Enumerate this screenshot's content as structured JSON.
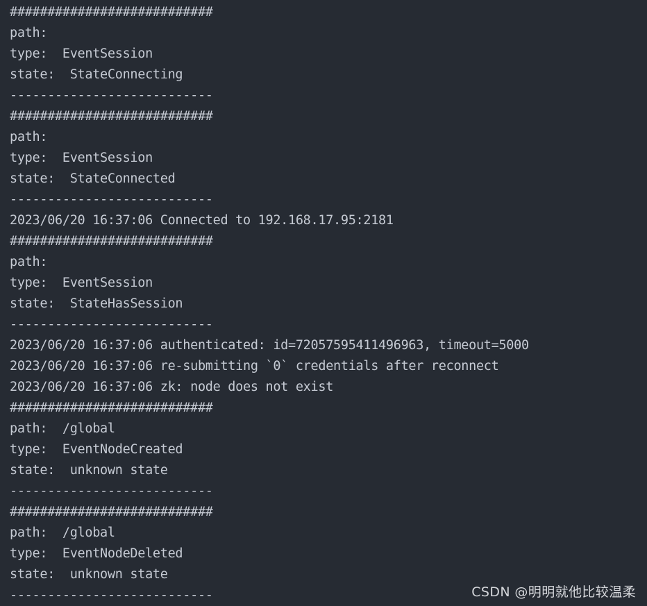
{
  "terminal": {
    "background_color": "#262b33",
    "text_color": "#c5cad3",
    "lines": [
      {
        "kind": "separator-hash",
        "text": "###########################"
      },
      {
        "kind": "field",
        "text": "path:"
      },
      {
        "kind": "field",
        "text": "type:  EventSession"
      },
      {
        "kind": "field",
        "text": "state:  StateConnecting"
      },
      {
        "kind": "separator-dash",
        "text": "---------------------------"
      },
      {
        "kind": "separator-hash",
        "text": "###########################"
      },
      {
        "kind": "field",
        "text": "path:"
      },
      {
        "kind": "field",
        "text": "type:  EventSession"
      },
      {
        "kind": "field",
        "text": "state:  StateConnected"
      },
      {
        "kind": "separator-dash",
        "text": "---------------------------"
      },
      {
        "kind": "log",
        "text": "2023/06/20 16:37:06 Connected to 192.168.17.95:2181"
      },
      {
        "kind": "separator-hash",
        "text": "###########################"
      },
      {
        "kind": "field",
        "text": "path:"
      },
      {
        "kind": "field",
        "text": "type:  EventSession"
      },
      {
        "kind": "field",
        "text": "state:  StateHasSession"
      },
      {
        "kind": "separator-dash",
        "text": "---------------------------"
      },
      {
        "kind": "log",
        "text": "2023/06/20 16:37:06 authenticated: id=72057595411496963, timeout=5000"
      },
      {
        "kind": "log",
        "text": "2023/06/20 16:37:06 re-submitting `0` credentials after reconnect"
      },
      {
        "kind": "log",
        "text": "2023/06/20 16:37:06 zk: node does not exist"
      },
      {
        "kind": "separator-hash",
        "text": "###########################"
      },
      {
        "kind": "field",
        "text": "path:  /global"
      },
      {
        "kind": "field",
        "text": "type:  EventNodeCreated"
      },
      {
        "kind": "field",
        "text": "state:  unknown state"
      },
      {
        "kind": "separator-dash",
        "text": "---------------------------"
      },
      {
        "kind": "separator-hash",
        "text": "###########################"
      },
      {
        "kind": "field",
        "text": "path:  /global"
      },
      {
        "kind": "field",
        "text": "type:  EventNodeDeleted"
      },
      {
        "kind": "field",
        "text": "state:  unknown state"
      },
      {
        "kind": "separator-dash",
        "text": "---------------------------"
      }
    ]
  },
  "watermark": {
    "text": "CSDN @明明就他比较温柔",
    "color": "#d4d6da"
  }
}
